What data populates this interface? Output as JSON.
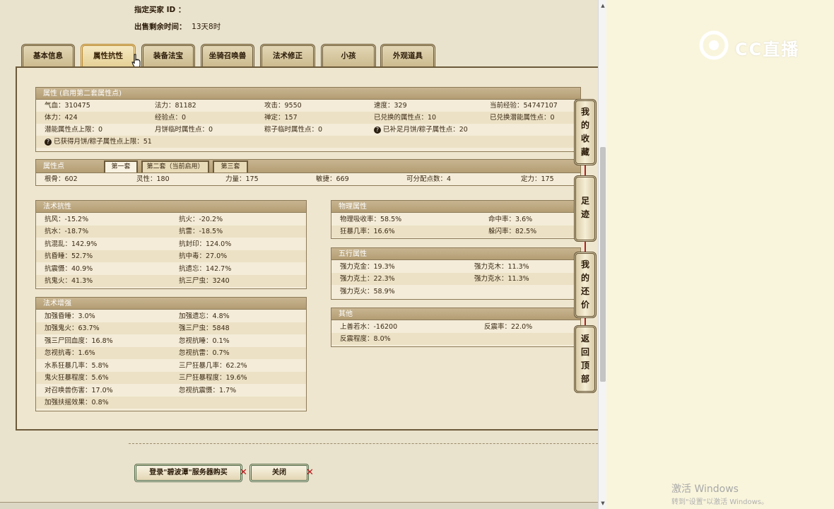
{
  "header": {
    "buyer_id_label": "指定买家 ID ：",
    "buyer_id_value": "",
    "remaining_label": "出售剩余时间：",
    "remaining_value": "13天8时"
  },
  "tabs": [
    "基本信息",
    "属性抗性",
    "装备法宝",
    "坐骑召唤兽",
    "法术修正",
    "小孩",
    "外观道具"
  ],
  "active_tab": "属性抗性",
  "attributes": {
    "title": "属性 (启用第二套属性点)",
    "rows": [
      [
        "气血：310475",
        "法力：81182",
        "攻击：9550",
        "速度：329",
        "当前经验：54747107"
      ],
      [
        "体力：424",
        "经验点：0",
        "禅定：157",
        "已兑换的属性点：10",
        "已兑换潜能属性点：0"
      ],
      [
        "潜能属性点上限：0",
        "月饼临时属性点：0",
        "粽子临时属性点：0",
        "已补足月饼/粽子属性点：20"
      ]
    ],
    "note": "已获得月饼/粽子属性点上限：51"
  },
  "points": {
    "title": "属性点",
    "subtabs": [
      "第一套",
      "第二套（当前启用）",
      "第三套"
    ],
    "values": [
      "根骨：602",
      "灵性：180",
      "力量：175",
      "敏捷：669",
      "可分配点数：4",
      "定力：175"
    ]
  },
  "resist": {
    "title": "法术抗性",
    "left": [
      "抗风：-15.2%",
      "抗水：-18.7%",
      "抗混乱：142.9%",
      "抗昏睡：52.7%",
      "抗震慑：40.9%",
      "抗鬼火：41.3%"
    ],
    "right": [
      "抗火：-20.2%",
      "抗雷：-18.5%",
      "抗封印：124.0%",
      "抗中毒：27.0%",
      "抗遗忘：142.7%",
      "抗三尸虫：3240"
    ]
  },
  "enhance": {
    "title": "法术增强",
    "left": [
      "加强昏睡：3.0%",
      "加强鬼火：63.7%",
      "强三尸回血度：16.8%",
      "忽视抗毒：1.6%",
      "水系狂暴几率：5.8%",
      "鬼火狂暴程度：5.6%",
      "对召唤兽伤害：17.0%",
      "加强扶摇效果：0.8%"
    ],
    "right": [
      "加强遗忘：4.8%",
      "强三尸虫：5848",
      "忽视抗睡：0.1%",
      "忽视抗雷：0.7%",
      "三尸狂暴几率：62.2%",
      "三尸狂暴程度：19.6%",
      "忽视抗震慑：1.7%"
    ]
  },
  "physical": {
    "title": "物理属性",
    "left": [
      "物理吸收率：58.5%",
      "狂暴几率：16.6%"
    ],
    "right": [
      "命中率：3.6%",
      "躲闪率：82.5%"
    ]
  },
  "wuxing": {
    "title": "五行属性",
    "left": [
      "强力克金：19.3%",
      "强力克土：22.3%",
      "强力克火：58.9%"
    ],
    "right": [
      "强力克木：11.3%",
      "强力克水：11.3%"
    ]
  },
  "other": {
    "title": "其他",
    "left": [
      "上善若水：-16200",
      "反震程度：8.0%"
    ],
    "right": [
      "反震率：22.0%"
    ]
  },
  "side_buttons": [
    [
      "我",
      "的",
      "收",
      "藏"
    ],
    [
      "足",
      "迹"
    ],
    [
      "我",
      "的",
      "还",
      "价"
    ],
    [
      "返",
      "回",
      "顶",
      "部"
    ]
  ],
  "actions": {
    "buy_label": "登录\"碧波潭\"服务器购买",
    "close_label": "关闭"
  },
  "watermark": {
    "logo_text": "CC直播",
    "activate_title": "激活 Windows",
    "activate_sub": "转到\"设置\"以激活 Windows。"
  },
  "colors": {
    "panel_bg": "#efe6cf",
    "section_header": "#b39d74",
    "active_tab_border": "#b8862e",
    "close_x": "#c0141a",
    "right_bg": "#f9f5dc"
  }
}
